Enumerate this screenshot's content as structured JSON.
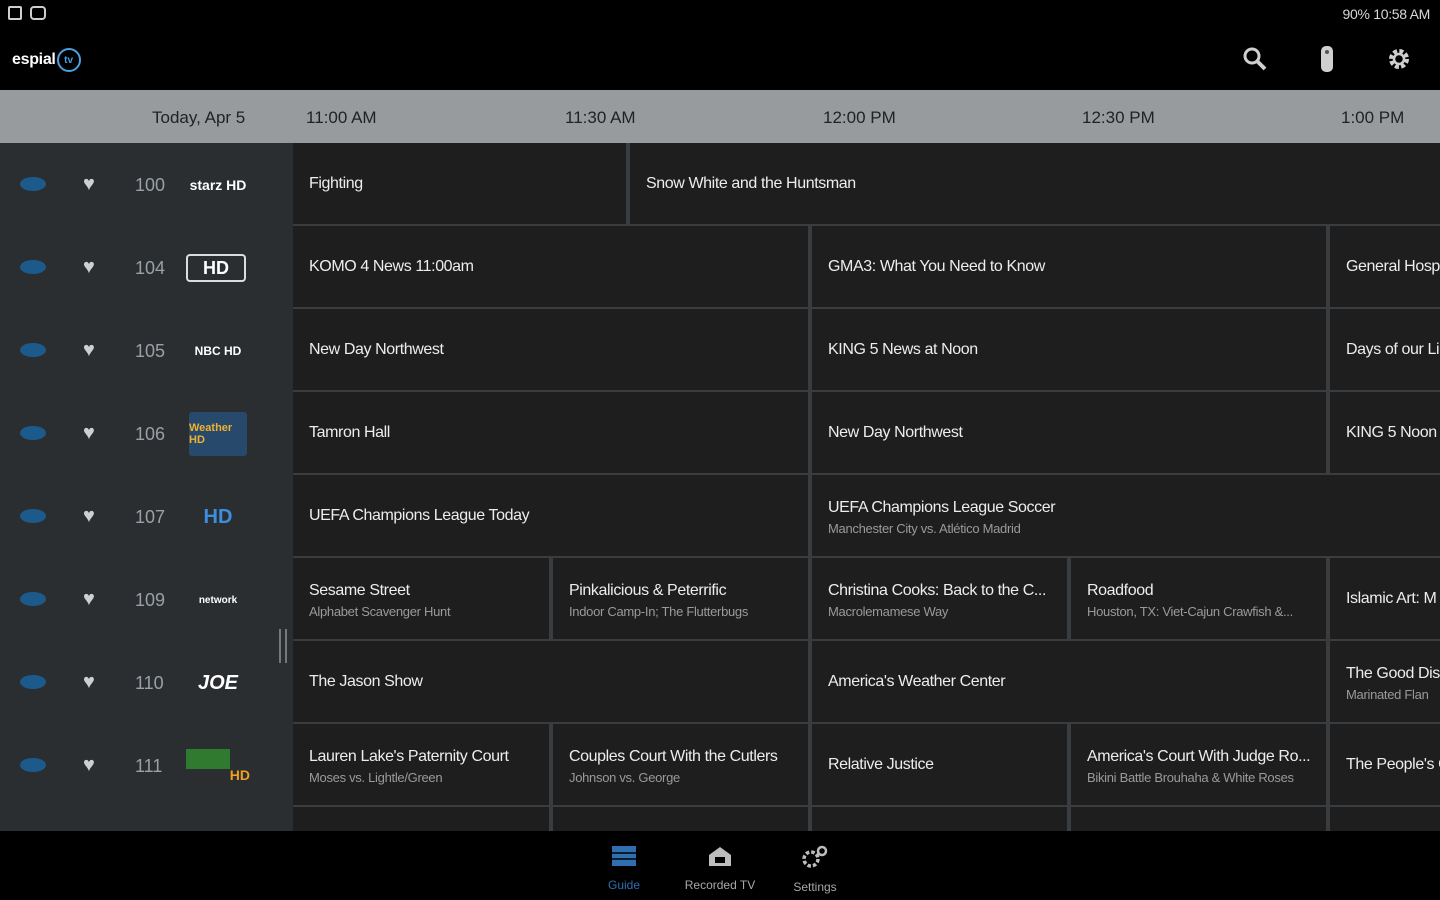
{
  "status_bar": {
    "right_text": "90% 10:58 AM"
  },
  "app": {
    "logo_text": "espial",
    "logo_badge": "tv"
  },
  "timeline": {
    "date": "Today, Apr  5",
    "slots": [
      "11:00 AM",
      "11:30 AM",
      "12:00 PM",
      "12:30 PM",
      "1:00 PM"
    ]
  },
  "channels": [
    {
      "number": "100",
      "logo": "starz HD"
    },
    {
      "number": "104",
      "logo": "HD"
    },
    {
      "number": "105",
      "logo": "NBC HD"
    },
    {
      "number": "106",
      "logo": "Weather HD"
    },
    {
      "number": "107",
      "logo": "HD"
    },
    {
      "number": "109",
      "logo": "network"
    },
    {
      "number": "110",
      "logo": "JOE"
    },
    {
      "number": "111",
      "logo": "HD"
    }
  ],
  "programs": [
    [
      {
        "title": "Fighting",
        "subtitle": ""
      },
      {
        "title": "Snow White and the Huntsman",
        "subtitle": ""
      }
    ],
    [
      {
        "title": "KOMO 4 News 11:00am",
        "subtitle": ""
      },
      {
        "title": "GMA3: What You Need to Know",
        "subtitle": ""
      },
      {
        "title": "General Hosp",
        "subtitle": ""
      }
    ],
    [
      {
        "title": "New Day Northwest",
        "subtitle": ""
      },
      {
        "title": "KING 5 News at Noon",
        "subtitle": ""
      },
      {
        "title": "Days of our Li",
        "subtitle": ""
      }
    ],
    [
      {
        "title": "Tamron Hall",
        "subtitle": ""
      },
      {
        "title": "New Day Northwest",
        "subtitle": ""
      },
      {
        "title": "KING 5 Noon",
        "subtitle": ""
      }
    ],
    [
      {
        "title": "UEFA Champions League Today",
        "subtitle": ""
      },
      {
        "title": "UEFA Champions League Soccer",
        "subtitle": "Manchester City vs. Atlético Madrid"
      }
    ],
    [
      {
        "title": "Sesame Street",
        "subtitle": "Alphabet Scavenger Hunt"
      },
      {
        "title": "Pinkalicious & Peterrific",
        "subtitle": "Indoor Camp-In; The Flutterbugs"
      },
      {
        "title": "Christina Cooks: Back to the C...",
        "subtitle": "Macrolemamese Way"
      },
      {
        "title": "Roadfood",
        "subtitle": "Houston, TX: Viet-Cajun Crawfish &..."
      },
      {
        "title": "Islamic Art: M",
        "subtitle": ""
      }
    ],
    [
      {
        "title": "The Jason Show",
        "subtitle": ""
      },
      {
        "title": "America's Weather Center",
        "subtitle": ""
      },
      {
        "title": "The Good Dis",
        "subtitle": "Marinated Flan"
      }
    ],
    [
      {
        "title": "Lauren Lake's Paternity Court",
        "subtitle": "Moses vs. Lightle/Green"
      },
      {
        "title": "Couples Court With the Cutlers",
        "subtitle": "Johnson vs. George"
      },
      {
        "title": "Relative Justice",
        "subtitle": ""
      },
      {
        "title": "America's Court With Judge Ro...",
        "subtitle": "Bikini Battle Brouhaha & White Roses"
      },
      {
        "title": "The People's C",
        "subtitle": ""
      }
    ]
  ],
  "bottom_nav": [
    {
      "label": "Guide",
      "icon": "guide-icon",
      "active": true
    },
    {
      "label": "Recorded TV",
      "icon": "recorded-tv-icon",
      "active": false
    },
    {
      "label": "Settings",
      "icon": "settings-icon",
      "active": false
    }
  ]
}
